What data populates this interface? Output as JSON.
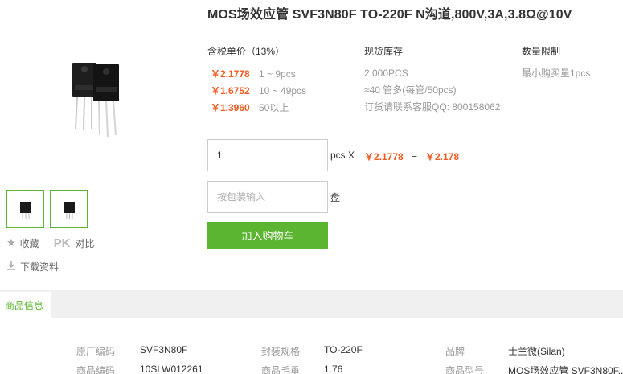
{
  "product": {
    "title": "MOS场效应管 SVF3N80F TO-220F N沟道,800V,3A,3.8Ω@10V"
  },
  "side": {
    "favorite_label": "收藏",
    "pk_label": "PK",
    "compare_label": "对比",
    "download_label": "下载资料"
  },
  "pricing": {
    "header": "含税单价（13%）",
    "tiers": [
      {
        "price": "￥2.1778",
        "range": "1 ~ 9pcs"
      },
      {
        "price": "￥1.6752",
        "range": "10 ~ 49pcs"
      },
      {
        "price": "￥1.3960",
        "range": "50以上"
      }
    ]
  },
  "stock": {
    "header": "现货库存",
    "quantity": "2,000PCS",
    "packs": "≈40 管多(每管/50pcs)",
    "contact": "订货请联系客服QQ: 800158062"
  },
  "limit": {
    "header": "数量限制",
    "min": "最小购买量1pcs"
  },
  "order": {
    "qty_value": "1",
    "pcs_x": "pcs X",
    "unit_price": "￥2.1778",
    "equals": "=",
    "total": "￥2.178",
    "pack_placeholder": "按包装输入",
    "pack_unit": "盘",
    "cart_button": "加入购物车"
  },
  "tabs": {
    "info": "商品信息"
  },
  "info": {
    "row1": [
      {
        "label": "原厂编码",
        "value": "SVF3N80F"
      },
      {
        "label": "封装规格",
        "value": "TO-220F"
      },
      {
        "label": "品牌",
        "value": "士兰微(Silan)"
      }
    ],
    "row2": [
      {
        "label": "商品编码",
        "value": "10SLW012261"
      },
      {
        "label": "商品毛重",
        "value": "1.76"
      },
      {
        "label": "商品型号",
        "value": "MOS场效应管 SVF3N80F..."
      }
    ]
  },
  "colors": {
    "accent_green": "#5cb531",
    "price_orange": "#f25a1f"
  }
}
